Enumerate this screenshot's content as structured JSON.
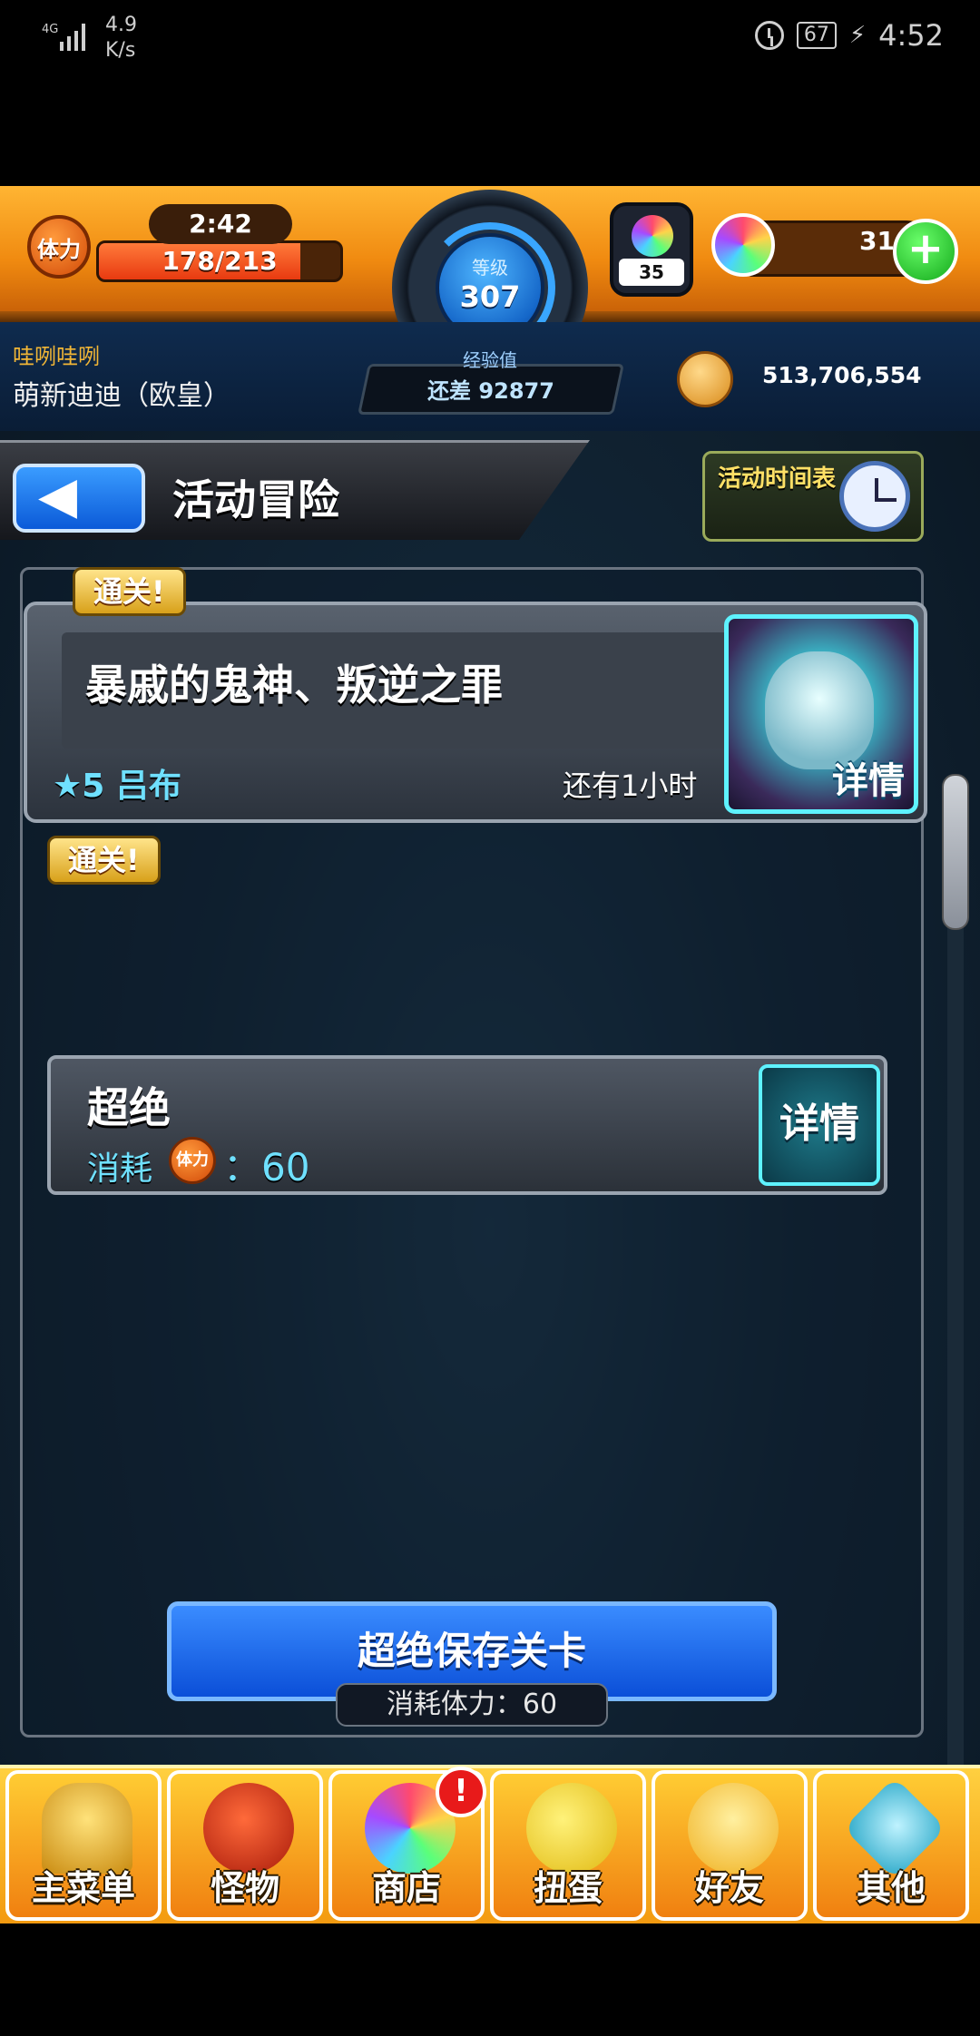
{
  "status_bar": {
    "network": "4G",
    "speed_value": "4.9",
    "speed_unit": "K/s",
    "battery": "67",
    "time": "4:52"
  },
  "hud": {
    "stamina_icon_label": "体力",
    "timer": "2:42",
    "stamina": "178/213",
    "stamina_fraction": 0.836,
    "level_label": "等级",
    "level_value": "307",
    "gem_count": "35",
    "crystal_count": "31",
    "plus_label": "+"
  },
  "user": {
    "id": "哇咧哇咧",
    "name": "萌新迪迪（欧皇）",
    "exp_label": "经验值",
    "exp_remaining": "还差 92877",
    "coins": "513,706,554"
  },
  "title_bar": {
    "back_label": "◀",
    "title": "活动冒险",
    "schedule_label": "活动时间表"
  },
  "event": {
    "clear_badge": "通关!",
    "name": "暴戚的鬼神、叛逆之罪",
    "boss": "★5 吕布",
    "time_left": "还有1小时",
    "detail_label": "详情"
  },
  "stage": {
    "clear_badge": "通关!",
    "name": "超绝",
    "cost_label": "消耗",
    "cost_icon_label": "体力",
    "cost_value": "：60",
    "detail_label": "详情"
  },
  "save": {
    "label": "超绝保存关卡",
    "cost": "消耗体力：60"
  },
  "nav": {
    "items": [
      {
        "label": "主菜单"
      },
      {
        "label": "怪物"
      },
      {
        "label": "商店"
      },
      {
        "label": "扭蛋"
      },
      {
        "label": "好友"
      },
      {
        "label": "其他"
      }
    ],
    "notice": "!"
  },
  "colors": {
    "hud_orange": "#f08a10",
    "accent_blue": "#0b5ad8",
    "cyan_text": "#6fe0ff",
    "badge_gold": "#d8a11a"
  }
}
